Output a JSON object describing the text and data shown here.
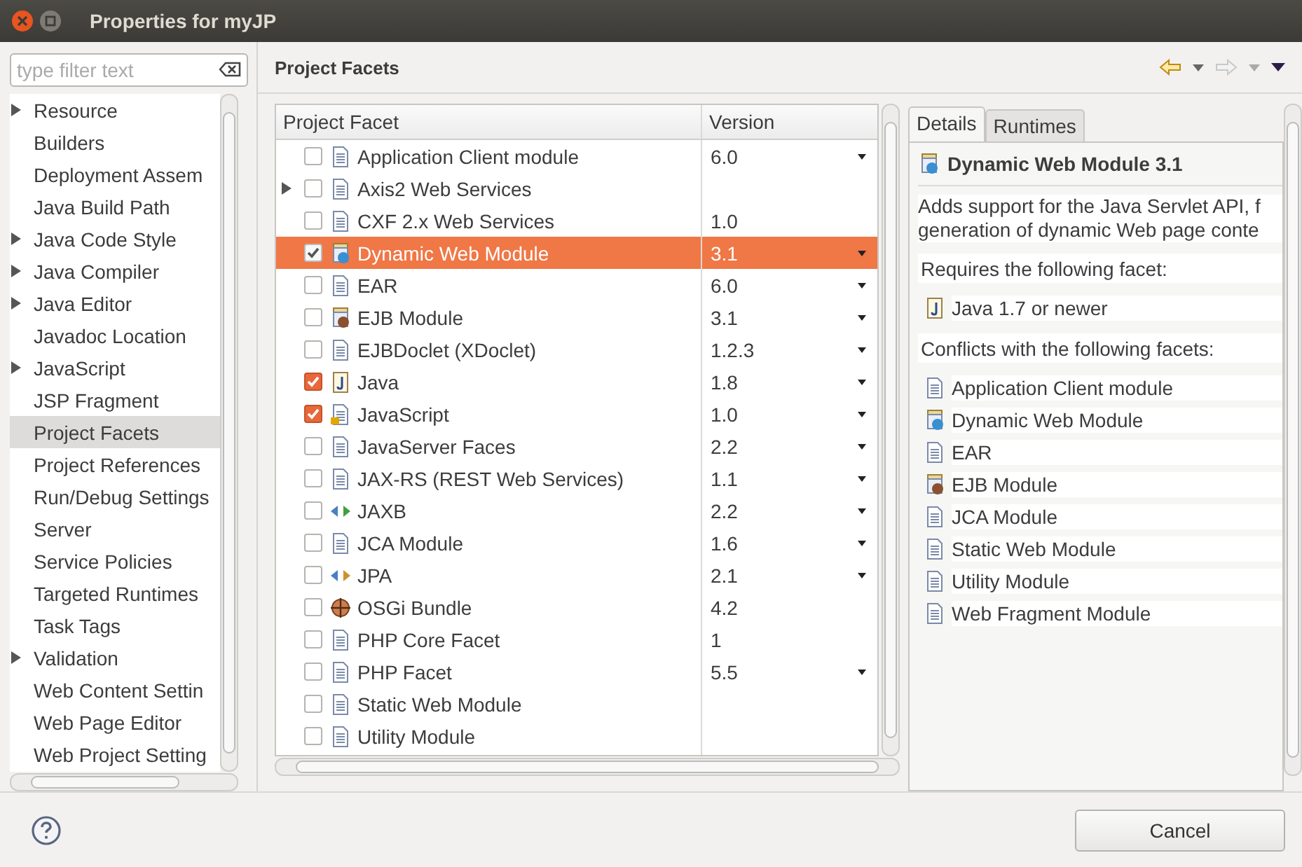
{
  "window": {
    "title": "Properties for myJP"
  },
  "filter": {
    "placeholder": "type filter text"
  },
  "sidebar": {
    "items": [
      {
        "label": "Resource",
        "expandable": true,
        "selected": false
      },
      {
        "label": "Builders",
        "expandable": false,
        "selected": false
      },
      {
        "label": "Deployment Assem",
        "expandable": false,
        "selected": false
      },
      {
        "label": "Java Build Path",
        "expandable": false,
        "selected": false
      },
      {
        "label": "Java Code Style",
        "expandable": true,
        "selected": false
      },
      {
        "label": "Java Compiler",
        "expandable": true,
        "selected": false
      },
      {
        "label": "Java Editor",
        "expandable": true,
        "selected": false
      },
      {
        "label": "Javadoc Location",
        "expandable": false,
        "selected": false
      },
      {
        "label": "JavaScript",
        "expandable": true,
        "selected": false
      },
      {
        "label": "JSP Fragment",
        "expandable": false,
        "selected": false
      },
      {
        "label": "Project Facets",
        "expandable": false,
        "selected": true
      },
      {
        "label": "Project References",
        "expandable": false,
        "selected": false
      },
      {
        "label": "Run/Debug Settings",
        "expandable": false,
        "selected": false
      },
      {
        "label": "Server",
        "expandable": false,
        "selected": false
      },
      {
        "label": "Service Policies",
        "expandable": false,
        "selected": false
      },
      {
        "label": "Targeted Runtimes",
        "expandable": false,
        "selected": false
      },
      {
        "label": "Task Tags",
        "expandable": false,
        "selected": false
      },
      {
        "label": "Validation",
        "expandable": true,
        "selected": false
      },
      {
        "label": "Web Content Settin",
        "expandable": false,
        "selected": false
      },
      {
        "label": "Web Page Editor",
        "expandable": false,
        "selected": false
      },
      {
        "label": "Web Project Setting",
        "expandable": false,
        "selected": false
      }
    ]
  },
  "page": {
    "title": "Project Facets"
  },
  "table": {
    "columns": [
      "Project Facet",
      "Version"
    ],
    "rows": [
      {
        "name": "Application Client module",
        "kind": "doc",
        "version": "6.0",
        "dropdown": true,
        "checked": false,
        "selected": false,
        "expandable": false
      },
      {
        "name": "Axis2 Web Services",
        "kind": "doc",
        "dropdown": false,
        "checked": false,
        "selected": false,
        "expandable": true
      },
      {
        "name": "CXF 2.x Web Services",
        "kind": "doc",
        "version": "1.0",
        "dropdown": false,
        "checked": false,
        "selected": false,
        "expandable": false
      },
      {
        "name": "Dynamic Web Module",
        "kind": "web",
        "version": "3.1",
        "dropdown": true,
        "checked": true,
        "selected": true,
        "expandable": false
      },
      {
        "name": "EAR",
        "kind": "doc",
        "version": "6.0",
        "dropdown": true,
        "checked": false,
        "selected": false,
        "expandable": false
      },
      {
        "name": "EJB Module",
        "kind": "ejb",
        "version": "3.1",
        "dropdown": true,
        "checked": false,
        "selected": false,
        "expandable": false
      },
      {
        "name": "EJBDoclet (XDoclet)",
        "kind": "doc",
        "version": "1.2.3",
        "dropdown": true,
        "checked": false,
        "selected": false,
        "expandable": false
      },
      {
        "name": "Java",
        "kind": "java",
        "version": "1.8",
        "dropdown": true,
        "checked": true,
        "selected": false,
        "expandable": false
      },
      {
        "name": "JavaScript",
        "kind": "js",
        "version": "1.0",
        "dropdown": true,
        "checked": true,
        "selected": false,
        "expandable": false
      },
      {
        "name": "JavaServer Faces",
        "kind": "doc",
        "version": "2.2",
        "dropdown": true,
        "checked": false,
        "selected": false,
        "expandable": false
      },
      {
        "name": "JAX-RS (REST Web Services)",
        "kind": "doc",
        "version": "1.1",
        "dropdown": true,
        "checked": false,
        "selected": false,
        "expandable": false
      },
      {
        "name": "JAXB",
        "kind": "jaxb",
        "version": "2.2",
        "dropdown": true,
        "checked": false,
        "selected": false,
        "expandable": false
      },
      {
        "name": "JCA Module",
        "kind": "doc",
        "version": "1.6",
        "dropdown": true,
        "checked": false,
        "selected": false,
        "expandable": false
      },
      {
        "name": "JPA",
        "kind": "jpa",
        "version": "2.1",
        "dropdown": true,
        "checked": false,
        "selected": false,
        "expandable": false
      },
      {
        "name": "OSGi Bundle",
        "kind": "osgi",
        "version": "4.2",
        "dropdown": false,
        "checked": false,
        "selected": false,
        "expandable": false
      },
      {
        "name": "PHP Core Facet",
        "kind": "doc",
        "version": "1",
        "dropdown": false,
        "checked": false,
        "selected": false,
        "expandable": false
      },
      {
        "name": "PHP Facet",
        "kind": "doc",
        "version": "5.5",
        "dropdown": true,
        "checked": false,
        "selected": false,
        "expandable": false
      },
      {
        "name": "Static Web Module",
        "kind": "doc",
        "dropdown": false,
        "checked": false,
        "selected": false,
        "expandable": false
      },
      {
        "name": "Utility Module",
        "kind": "doc",
        "dropdown": false,
        "checked": false,
        "selected": false,
        "expandable": false
      }
    ]
  },
  "details": {
    "tabs": [
      {
        "label": "Details",
        "selected": true
      },
      {
        "label": "Runtimes",
        "selected": false
      }
    ],
    "title": "Dynamic Web Module 3.1",
    "description_lines": [
      "Adds support for the Java Servlet API, f",
      "generation of dynamic Web page conte"
    ],
    "requires_heading": "Requires the following facet:",
    "requires": [
      {
        "name": "Java 1.7 or newer",
        "kind": "java"
      }
    ],
    "conflicts_heading": "Conflicts with the following facets:",
    "conflicts": [
      {
        "name": "Application Client module",
        "kind": "doc"
      },
      {
        "name": "Dynamic Web Module",
        "kind": "web"
      },
      {
        "name": "EAR",
        "kind": "doc"
      },
      {
        "name": "EJB Module",
        "kind": "ejb"
      },
      {
        "name": "JCA Module",
        "kind": "doc"
      },
      {
        "name": "Static Web Module",
        "kind": "doc"
      },
      {
        "name": "Utility Module",
        "kind": "doc"
      },
      {
        "name": "Web Fragment Module",
        "kind": "doc"
      }
    ]
  },
  "buttons": [
    "Cancel"
  ]
}
